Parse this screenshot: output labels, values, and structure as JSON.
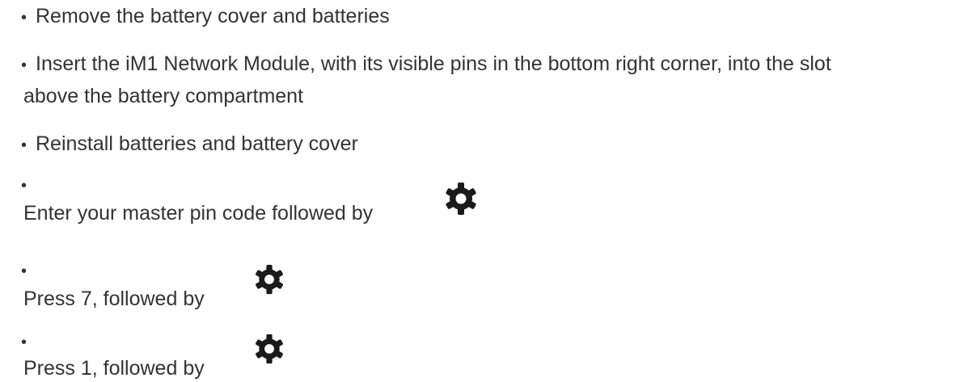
{
  "list": {
    "bullet": "•",
    "items": [
      {
        "text": "Remove the battery cover and batteries"
      },
      {
        "text_line1": "Insert the iM1 Network Module, with its visible pins in the bottom right corner, into the slot",
        "text_line2": "above the battery compartment"
      },
      {
        "text": "Reinstall batteries and battery cover"
      },
      {
        "text": "Enter your master pin code followed by",
        "icon": "gear-icon"
      },
      {
        "text": "Press 7, followed by",
        "icon": "gear-icon"
      },
      {
        "text": "Press 1, followed by",
        "icon": "gear-icon"
      }
    ]
  },
  "colors": {
    "text": "#333333",
    "icon": "#1a1a1a",
    "background": "#ffffff"
  }
}
